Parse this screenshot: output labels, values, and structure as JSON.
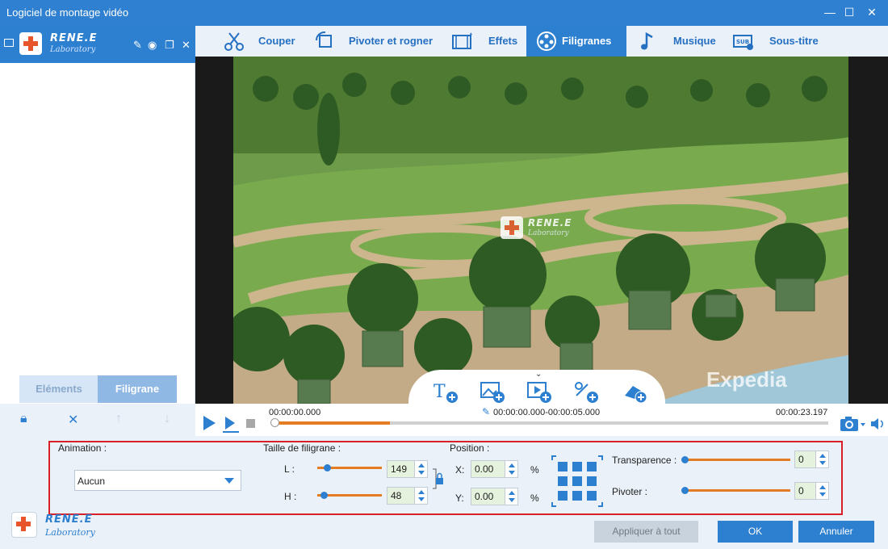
{
  "window": {
    "title": "Logiciel de montage vidéo"
  },
  "brand": {
    "name": "RENE.E",
    "sub": "Laboratory"
  },
  "tabs": [
    {
      "label": "Couper",
      "icon": "scissors-icon"
    },
    {
      "label": "Pivoter et rogner",
      "icon": "rotate-crop-icon"
    },
    {
      "label": "Effets",
      "icon": "effects-film-icon"
    },
    {
      "label": "Filigranes",
      "icon": "watermark-film-icon",
      "active": true
    },
    {
      "label": "Musique",
      "icon": "music-note-icon"
    },
    {
      "label": "Sous-titre",
      "icon": "subtitle-icon"
    }
  ],
  "left_tabs": {
    "elements": "Eléments",
    "filigrane": "Filigrane"
  },
  "video": {
    "overlay_brand": "RENE.E",
    "overlay_sub": "Laboratory",
    "expedia": "Expedia"
  },
  "playback": {
    "current": "00:00:00.000",
    "range": "00:00:00.000-00:00:05.000",
    "total": "00:00:23.197",
    "progress": 0.208
  },
  "settings": {
    "animation_label": "Animation :",
    "animation_value": "Aucun",
    "size_label": "Taille de filigrane :",
    "l_label": "L :",
    "h_label": "H :",
    "l_value": "149",
    "h_value": "48",
    "position_label": "Position :",
    "x_label": "X:",
    "y_label": "Y:",
    "x_value": "0.00",
    "y_value": "0.00",
    "percent": "%",
    "transparency_label": "Transparence :",
    "transparency_value": "0",
    "rotate_label": "Pivoter :",
    "rotate_value": "0"
  },
  "buttons": {
    "apply_all": "Appliquer à tout",
    "ok": "OK",
    "cancel": "Annuler"
  },
  "colors": {
    "accent": "#2d7fd0",
    "orange": "#e37c22",
    "highlight": "#d9202a",
    "panel": "#eaf1f9"
  }
}
